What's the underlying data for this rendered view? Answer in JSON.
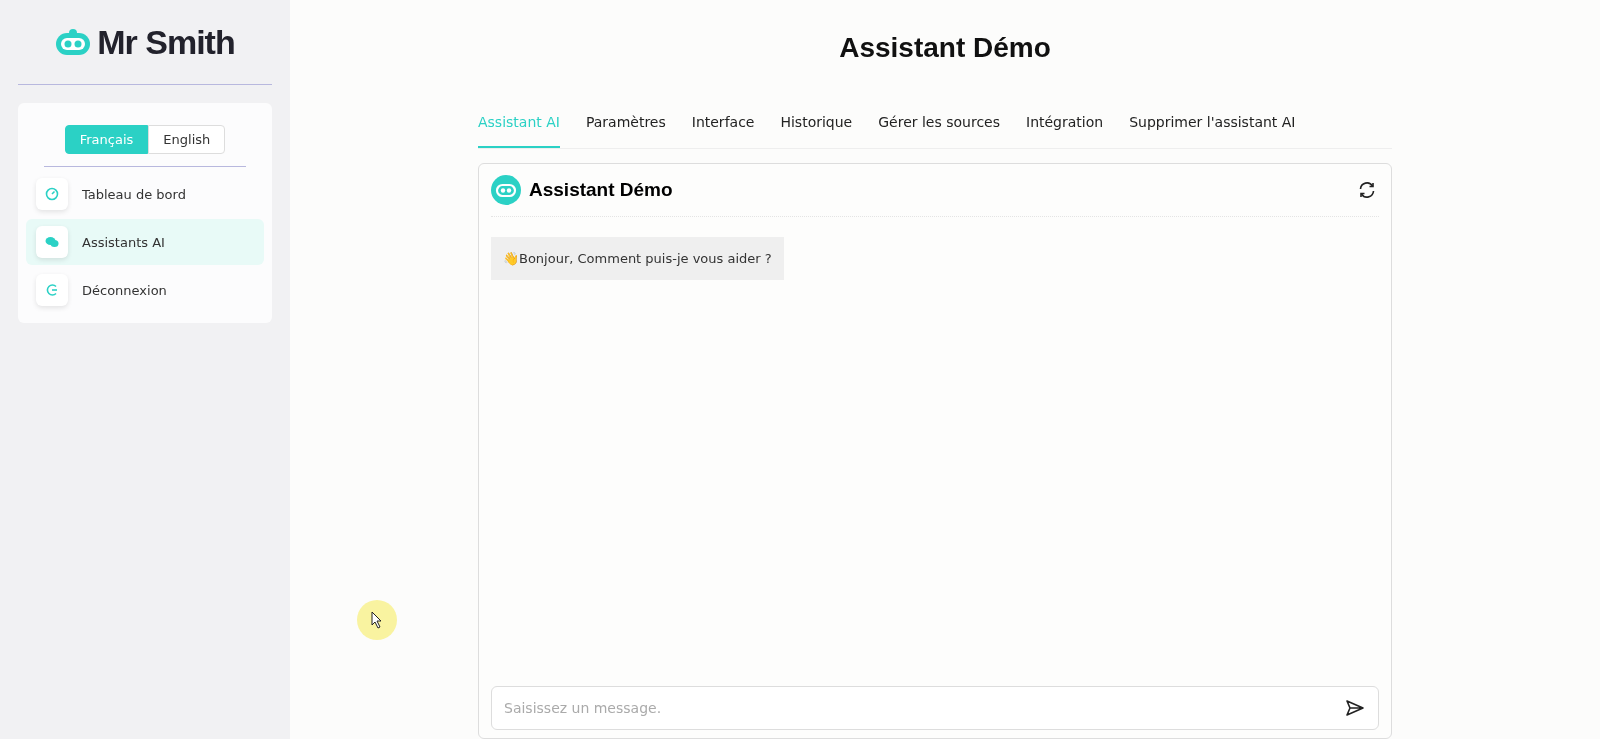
{
  "sidebar": {
    "logo": "Mr Smith",
    "languages": [
      {
        "label": "Français",
        "selected": true
      },
      {
        "label": "English",
        "selected": false
      }
    ],
    "items": [
      {
        "label": "Tableau de bord",
        "kind": "dashboard",
        "selected": false
      },
      {
        "label": "Assistants AI",
        "kind": "chat",
        "selected": true
      },
      {
        "label": "Déconnexion",
        "kind": "logout",
        "selected": false
      }
    ]
  },
  "page_title": "Assistant Démo",
  "tabs": [
    {
      "label": "Assistant AI",
      "selected": true
    },
    {
      "label": "Paramètres",
      "selected": false
    },
    {
      "label": "Interface",
      "selected": false
    },
    {
      "label": "Historique",
      "selected": false
    },
    {
      "label": "Gérer les sources",
      "selected": false
    },
    {
      "label": "Intégration",
      "selected": false
    },
    {
      "label": "Supprimer l'assistant AI",
      "selected": false
    }
  ],
  "chat": {
    "title": "Assistant Démo",
    "messages": [
      {
        "text": "👋Bonjour, Comment puis-je vous aider ?"
      }
    ],
    "input": {
      "placeholder": "Saisissez un message."
    }
  }
}
